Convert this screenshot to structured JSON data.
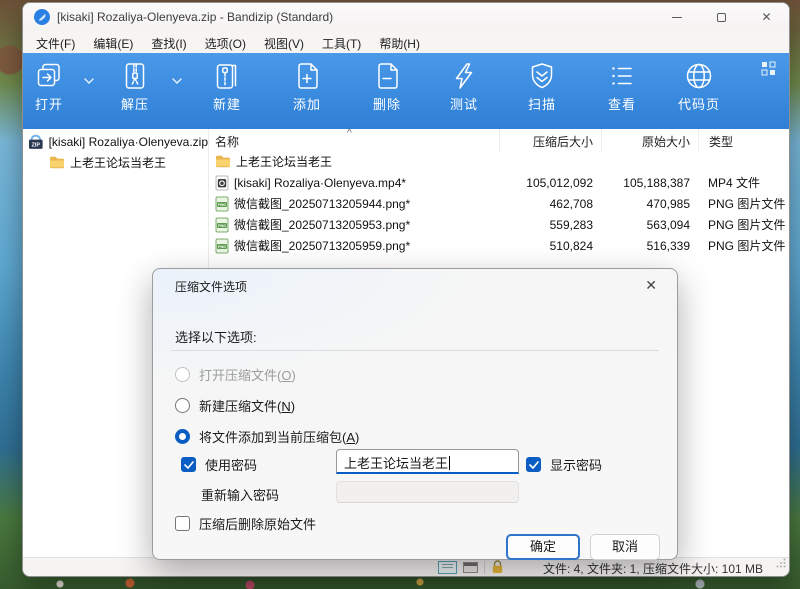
{
  "window": {
    "title": "[kisaki] Rozaliya-Olenyeva.zip - Bandizip (Standard)",
    "close_glyph": "✕"
  },
  "menu": {
    "items": [
      "文件(F)",
      "编辑(E)",
      "查找(I)",
      "选项(O)",
      "视图(V)",
      "工具(T)",
      "帮助(H)"
    ]
  },
  "toolbar": {
    "buttons": [
      "打开",
      "解压",
      "新建",
      "添加",
      "删除",
      "测试",
      "扫描",
      "查看",
      "代码页"
    ]
  },
  "sidebar": {
    "items": [
      {
        "label": "[kisaki] Rozaliya·Olenyeva.zip"
      },
      {
        "label": "上老王论坛当老王"
      }
    ]
  },
  "filelist": {
    "sort_glyph": "^",
    "columns": {
      "name": "名称",
      "packed": "压缩后大小",
      "original": "原始大小",
      "type": "类型"
    },
    "rows": [
      {
        "name": "上老王论坛当老王",
        "packed": "",
        "original": "",
        "type": ""
      },
      {
        "name": "[kisaki] Rozaliya·Olenyeva.mp4*",
        "packed": "105,012,092",
        "original": "105,188,387",
        "type": "MP4 文件"
      },
      {
        "name": "微信截图_20250713205944.png*",
        "packed": "462,708",
        "original": "470,985",
        "type": "PNG 图片文件"
      },
      {
        "name": "微信截图_20250713205953.png*",
        "packed": "559,283",
        "original": "563,094",
        "type": "PNG 图片文件"
      },
      {
        "name": "微信截图_20250713205959.png*",
        "packed": "510,824",
        "original": "516,339",
        "type": "PNG 图片文件"
      }
    ]
  },
  "statusbar": {
    "summary": "文件: 4, 文件夹: 1, 压缩文件大小: 101 MB"
  },
  "dialog": {
    "title": "压缩文件选项",
    "close_glyph": "✕",
    "prompt": "选择以下选项:",
    "radio_open": {
      "prefix": "打开压缩文件(",
      "key": "O",
      "suffix": ")"
    },
    "radio_new": {
      "prefix": "新建压缩文件(",
      "key": "N",
      "suffix": ")"
    },
    "radio_add": {
      "prefix": "将文件添加到当前压缩包(",
      "key": "A",
      "suffix": ")"
    },
    "use_password_label": "使用密码",
    "password_value": "上老王论坛当老王",
    "show_password_label": "显示密码",
    "reenter_label": "重新输入密码",
    "delete_original_label": "压缩后删除原始文件",
    "ok_label": "确定",
    "cancel_label": "取消"
  },
  "colors": {
    "accent": "#0a5dc2",
    "toolbar_blue": "#3a8ade"
  }
}
